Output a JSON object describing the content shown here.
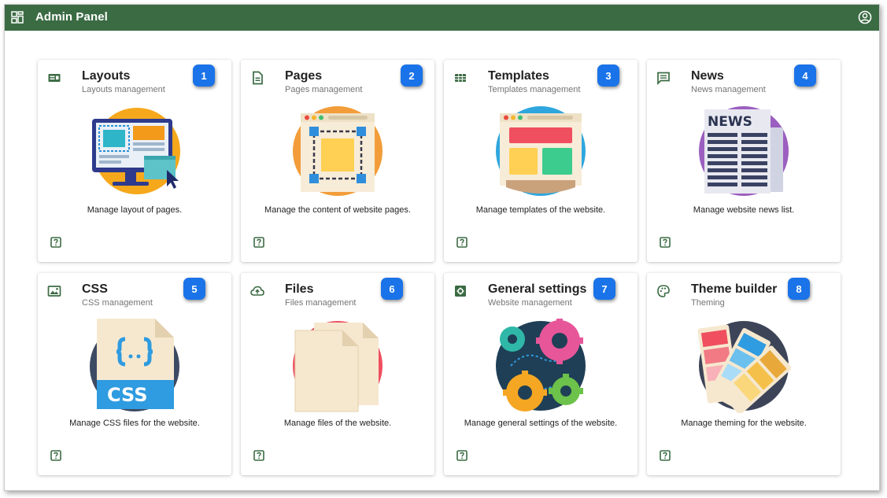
{
  "header": {
    "title": "Admin Panel",
    "apps_icon": "dashboard-grid-icon",
    "account_icon": "account-circle-icon",
    "color": "#3b6b43"
  },
  "cards": [
    {
      "title": "Layouts",
      "subtitle": "Layouts management",
      "description": "Manage layout of pages.",
      "badge": "1",
      "icon": "layout-icon"
    },
    {
      "title": "Pages",
      "subtitle": "Pages management",
      "description": "Manage the content of website pages.",
      "badge": "2",
      "icon": "page-icon"
    },
    {
      "title": "Templates",
      "subtitle": "Templates management",
      "description": "Manage templates of the website.",
      "badge": "3",
      "icon": "grid-icon"
    },
    {
      "title": "News",
      "subtitle": "News management",
      "description": "Manage website news list.",
      "badge": "4",
      "icon": "news-icon"
    },
    {
      "title": "CSS",
      "subtitle": "CSS management",
      "description": "Manage CSS files for the website.",
      "badge": "5",
      "icon": "image-icon"
    },
    {
      "title": "Files",
      "subtitle": "Files management",
      "description": "Manage files of the website.",
      "badge": "6",
      "icon": "cloud-upload-icon"
    },
    {
      "title": "General settings",
      "subtitle": "Website management",
      "description": "Manage general settings of the website.",
      "badge": "7",
      "icon": "settings-icon"
    },
    {
      "title": "Theme builder",
      "subtitle": "Theming",
      "description": "Manage theming for the website.",
      "badge": "8",
      "icon": "palette-icon"
    }
  ],
  "illustration_labels": {
    "news": "NEWS",
    "css": "CSS"
  },
  "badge_color": "#1a73e8",
  "icon_color": "#3b6b43"
}
